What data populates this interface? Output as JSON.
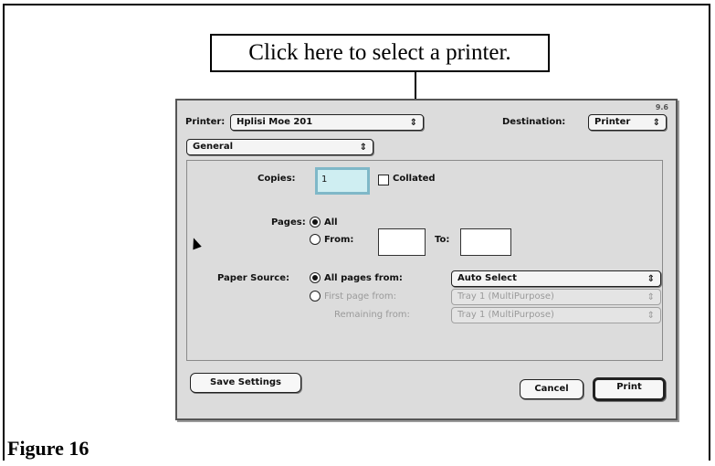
{
  "callout": {
    "text": "Click here to select a printer."
  },
  "figure": {
    "label": "Figure 16"
  },
  "dialog": {
    "version": "9.6",
    "printer_label": "Printer:",
    "printer_value": "Hplisi Moe 201",
    "destination_label": "Destination:",
    "destination_value": "Printer",
    "panel_value": "General",
    "copies_label": "Copies:",
    "copies_value": "1",
    "collated_label": "Collated",
    "pages_label": "Pages:",
    "pages_all_label": "All",
    "pages_from_label": "From:",
    "pages_to_label": "To:",
    "paper_source_label": "Paper Source:",
    "all_pages_from_label": "All pages from:",
    "all_pages_from_value": "Auto Select",
    "first_page_from_label": "First page from:",
    "first_page_from_value": "Tray 1 (MultiPurpose)",
    "remaining_from_label": "Remaining from:",
    "remaining_from_value": "Tray 1 (MultiPurpose)",
    "save_settings_label": "Save Settings",
    "cancel_label": "Cancel",
    "print_label": "Print"
  },
  "icons": {
    "popup_arrows": "⇕",
    "cursor": "mouse-pointer"
  }
}
